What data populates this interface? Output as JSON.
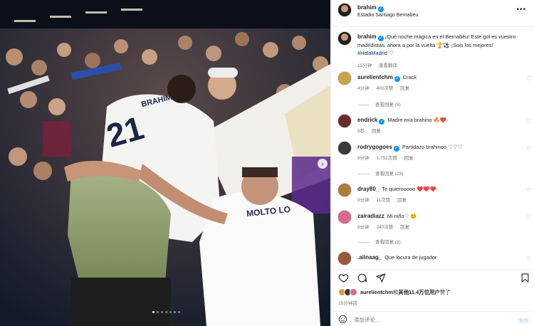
{
  "post": {
    "author": "brahim",
    "location": "Estadio Santiago Bernabéu",
    "more_icon": "more-horizontal-icon"
  },
  "photo": {
    "jersey_number": "21",
    "jersey_name": "BRAHIM",
    "flag_text": "MOLTO LO",
    "next_icon": "chevron-right-icon",
    "dots_count": 7
  },
  "caption": {
    "author": "brahim",
    "text": "¡Qué noche mágica en el Bernabéu! Este gol es vuestro madridistas, ahora a por la vuelta 🏆⚽ ¡Sois los mejores! ",
    "hashtag": "#HalaMadrid",
    "trailing": " ♡",
    "time": "15分钟",
    "translate": "查看翻译"
  },
  "comments": [
    {
      "user": "aurelientchm",
      "verified": true,
      "text": "Crack",
      "time": "4分钟",
      "likes": "400次赞",
      "reply": "回复",
      "replies": "查看回复 (6)",
      "avatar_color": "#c9a24a"
    },
    {
      "user": "endrick",
      "verified": true,
      "text": "Madre mía brahino 🔥❤️",
      "time": "8秒",
      "likes": "",
      "reply": "回复",
      "replies": "",
      "avatar_color": "#6b2c2c"
    },
    {
      "user": "rodrygogoes",
      "verified": true,
      "text": "Partidazo brahinoo ♡♡♡",
      "time": "9分钟",
      "likes": "1,752次赞",
      "reply": "回复",
      "replies": "查看回复 (23)",
      "avatar_color": "#3a3a3a"
    },
    {
      "user": "dray80_",
      "verified": false,
      "text": "Te quierooooo ❤️❤️❤️",
      "time": "9分钟",
      "likes": "11次赞",
      "reply": "回复",
      "replies": "",
      "avatar_color": "#b07a3a"
    },
    {
      "user": "zairadiazz",
      "verified": false,
      "text": "Mi niño♡ 😊",
      "time": "8分钟",
      "likes": "240次赞",
      "reply": "回复",
      "replies": "查看回复 (3)",
      "avatar_color": "#d86a8c"
    },
    {
      "user": ".aiinaag_",
      "verified": false,
      "text": "Que locura de jugador",
      "time": "",
      "likes": "",
      "reply": "",
      "replies": "",
      "avatar_color": "#9a5a3a"
    }
  ],
  "actions": {
    "like_icon": "heart-icon",
    "comment_icon": "comment-icon",
    "share_icon": "send-icon",
    "save_icon": "bookmark-icon"
  },
  "likes": {
    "first_user": "aurelientchm",
    "connector": "和",
    "others": "其他11.4万位用户",
    "suffix": "赞了",
    "avatar_colors": [
      "#c9a24a",
      "#3a3a3a",
      "#d86a8c"
    ]
  },
  "post_time": "15分钟前",
  "add_comment": {
    "placeholder": "添加评论...",
    "post_label": "发布"
  },
  "colors": {
    "verified": "#0095f6",
    "hashtag": "#00376b",
    "muted": "#737373"
  }
}
